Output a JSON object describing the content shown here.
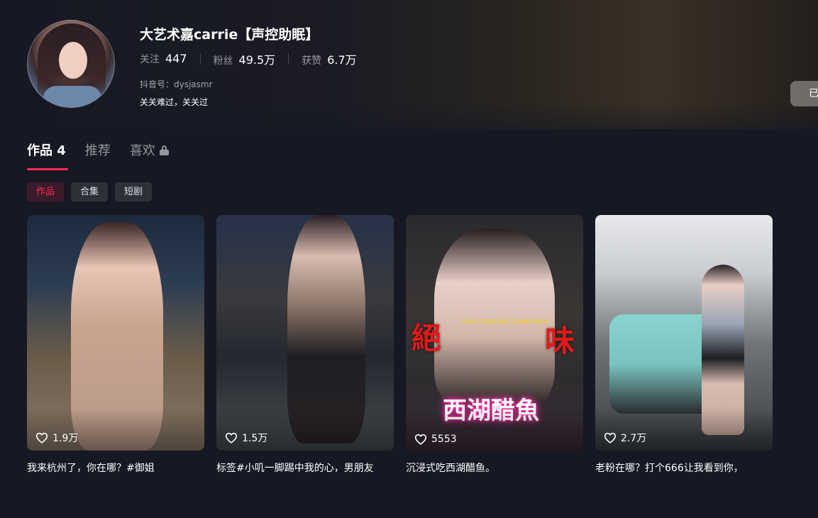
{
  "profile": {
    "nickname": "大艺术嘉carrie【声控助眠】",
    "stats": [
      {
        "label": "关注",
        "value": "447"
      },
      {
        "label": "粉丝",
        "value": "49.5万"
      },
      {
        "label": "获赞",
        "value": "6.7万"
      }
    ],
    "douyin_id": "抖音号：dysjasmr",
    "bio": "关关难过，关关过",
    "followed_button": "已"
  },
  "tabs": [
    {
      "label": "作品 4"
    },
    {
      "label": "推荐"
    },
    {
      "label": "喜欢",
      "icon": "lock-icon"
    }
  ],
  "chips": [
    "作品",
    "合集",
    "短剧"
  ],
  "videos": [
    {
      "likes": "1.9万",
      "caption": "我来杭州了，你在哪？#御姐"
    },
    {
      "likes": "1.5万",
      "caption": "标签#小叽一脚踢中我的心，男朋友"
    },
    {
      "likes": "5553",
      "caption": "沉浸式吃西湖醋鱼。",
      "overlay_left": "絕",
      "overlay_right": "味",
      "overlay_title": "西湖醋魚",
      "overlay_small": "HIGH SEASONS DUMPLINGS"
    },
    {
      "likes": "2.7万",
      "caption": "老粉在哪？打个666让我看到你，"
    }
  ],
  "colors": {
    "accent": "#fe2c55",
    "background": "#161823"
  }
}
